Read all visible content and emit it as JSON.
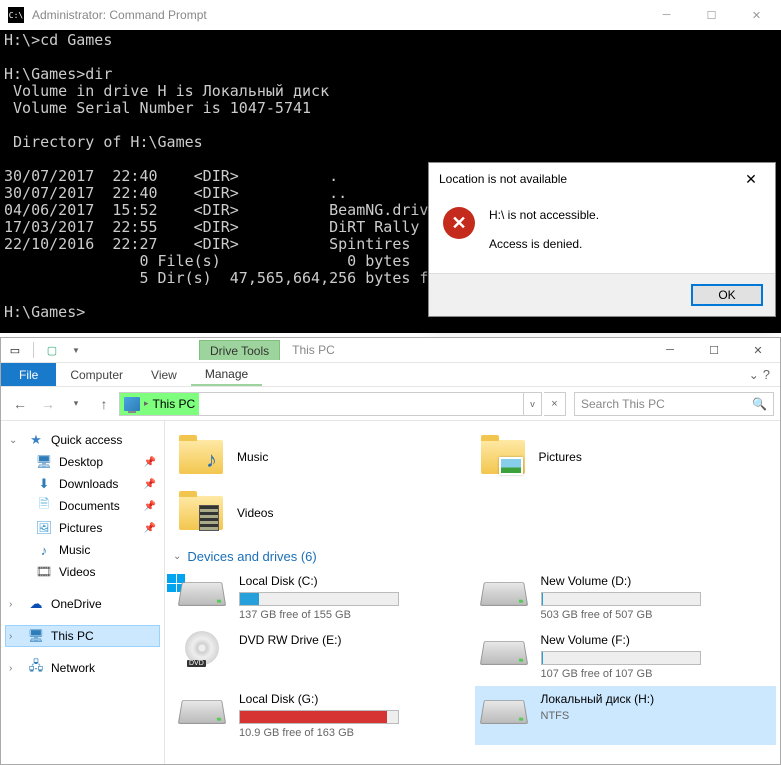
{
  "cmd": {
    "title": "Administrator: Command Prompt",
    "lines": "H:\\>cd Games\n\nH:\\Games>dir\n Volume in drive H is Локальный диск\n Volume Serial Number is 1047-5741\n\n Directory of H:\\Games\n\n30/07/2017  22:40    <DIR>          .\n30/07/2017  22:40    <DIR>          ..\n04/06/2017  15:52    <DIR>          BeamNG.drive 0.9.\n17/03/2017  22:55    <DIR>          DiRT Rally\n22/10/2016  22:27    <DIR>          Spintires\n               0 File(s)              0 bytes\n               5 Dir(s)  47,565,664,256 bytes free\n\nH:\\Games>"
  },
  "dialog": {
    "title": "Location is not available",
    "line1": "H:\\ is not accessible.",
    "line2": "Access is denied.",
    "ok": "OK"
  },
  "explorer": {
    "drive_tools": "Drive Tools",
    "title": "This PC",
    "menu": {
      "file": "File",
      "computer": "Computer",
      "view": "View",
      "manage": "Manage"
    },
    "address": "This PC",
    "search_placeholder": "Search This PC",
    "sidebar": {
      "quick": "Quick access",
      "desktop": "Desktop",
      "downloads": "Downloads",
      "documents": "Documents",
      "pictures": "Pictures",
      "music": "Music",
      "videos": "Videos",
      "onedrive": "OneDrive",
      "thispc": "This PC",
      "network": "Network"
    },
    "folders": {
      "music": "Music",
      "pictures": "Pictures",
      "videos": "Videos"
    },
    "section": "Devices and drives (6)",
    "drives": {
      "c": {
        "name": "Local Disk (C:)",
        "free": "137 GB free of 155 GB",
        "pct": 12
      },
      "d": {
        "name": "New Volume (D:)",
        "free": "503 GB free of 507 GB",
        "pct": 1
      },
      "e": {
        "name": "DVD RW Drive (E:)"
      },
      "f": {
        "name": "New Volume (F:)",
        "free": "107 GB free of 107 GB",
        "pct": 0
      },
      "g": {
        "name": "Local Disk (G:)",
        "free": "10.9 GB free of 163 GB",
        "pct": 93
      },
      "h": {
        "name": "Локальный диск (H:)",
        "fs": "NTFS"
      }
    }
  }
}
